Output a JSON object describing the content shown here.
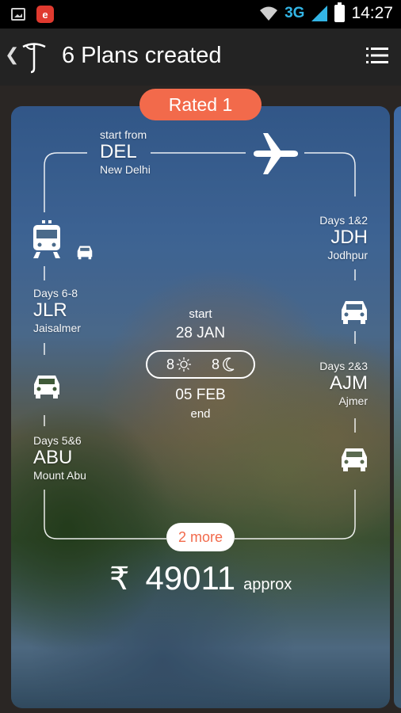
{
  "status_bar": {
    "network": "3G",
    "time": "14:27",
    "icons": [
      "gallery-icon",
      "app-notification-icon",
      "wifi-icon",
      "signal-icon",
      "battery-icon"
    ]
  },
  "app_bar": {
    "title": "6 Plans created",
    "icons": [
      "back-chevron-icon",
      "app-logo-icon",
      "menu-icon"
    ]
  },
  "card": {
    "rating_label": "Rated 1",
    "origin": {
      "caption": "start from",
      "code": "DEL",
      "city": "New Delhi",
      "transport": "plane-icon"
    },
    "stops": [
      {
        "days": "Days 1&2",
        "code": "JDH",
        "city": "Jodhpur"
      },
      {
        "days": "Days 2&3",
        "code": "AJM",
        "city": "Ajmer"
      },
      {
        "days": "Days 5&6",
        "code": "ABU",
        "city": "Mount Abu"
      },
      {
        "days": "Days 6-8",
        "code": "JLR",
        "city": "Jaisalmer"
      }
    ],
    "trip": {
      "start_label": "start",
      "start_date": "28 JAN",
      "days": "8",
      "nights": "8",
      "end_date": "05 FEB",
      "end_label": "end"
    },
    "more_label": "2 more",
    "price": {
      "currency": "₹",
      "amount": "49011",
      "suffix": "approx"
    }
  },
  "colors": {
    "accent": "#f26a4b",
    "app_bar": "#232323",
    "status_network": "#33b5e5"
  }
}
